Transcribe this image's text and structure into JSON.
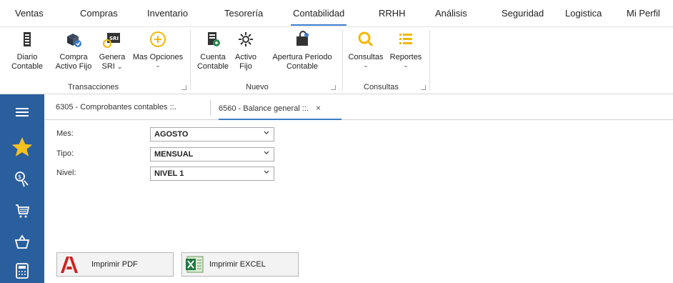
{
  "menu": {
    "items": [
      "Ventas",
      "Compras",
      "Inventario",
      "Tesorería",
      "Contabilidad",
      "RRHH",
      "Análisis",
      "Seguridad",
      "Logistica",
      "Mi Perfil"
    ],
    "active": "Contabilidad"
  },
  "ribbon": {
    "transacciones": {
      "label": "Transacciones",
      "diario": [
        "Diario",
        "Contable"
      ],
      "compra": [
        "Compra",
        "Activo Fijo"
      ],
      "genera": [
        "Genera",
        "SRI"
      ],
      "genera_badge": "SRI",
      "mas": "Mas Opciones"
    },
    "nuevo": {
      "label": "Nuevo",
      "cuenta": [
        "Cuenta",
        "Contable"
      ],
      "activo": [
        "Activo",
        "Fijo"
      ],
      "apertura": [
        "Apertura Periodo",
        "Contable"
      ]
    },
    "consultas": {
      "label": "Consultas",
      "consultas": "Consultas",
      "reportes": "Reportes"
    }
  },
  "tabs": [
    {
      "label": "6305 - Comprobantes contables ::.",
      "active": false
    },
    {
      "label": "6560 - Balance general ::.",
      "active": true,
      "close": "×"
    }
  ],
  "form": {
    "mes_label": "Mes:",
    "mes_value": "AGOSTO",
    "tipo_label": "Tipo:",
    "tipo_value": "MENSUAL",
    "nivel_label": "Nivel:",
    "nivel_value": "NIVEL 1"
  },
  "buttons": {
    "pdf": "Imprimir PDF",
    "excel": "Imprimir EXCEL"
  },
  "colors": {
    "sidebar": "#2a5f9e",
    "accent": "#3c7cc9",
    "star": "#f7c21b",
    "ribbon_icon_yellow": "#f2b705"
  }
}
